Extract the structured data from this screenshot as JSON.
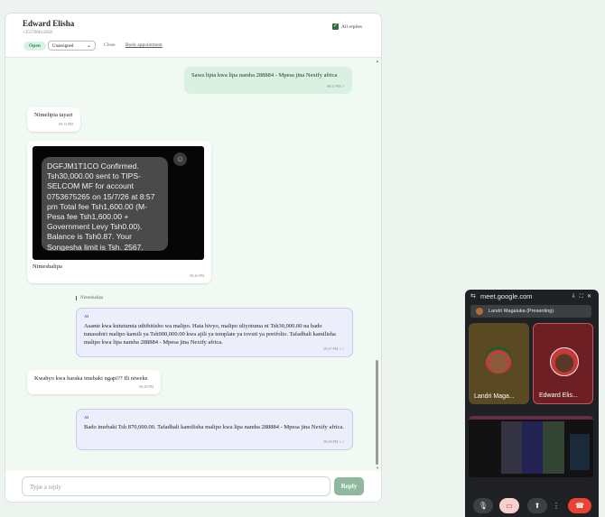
{
  "contact": {
    "name": "Edward Elisha",
    "phone": "+255766615858"
  },
  "header": {
    "status": "Open",
    "assignee": "Unassigned",
    "close_label": "Close",
    "book_label": "Book appointment",
    "all_replies_label": "All replies",
    "all_replies_checked": true
  },
  "messages": [
    {
      "dir": "out",
      "text": "Sawa lipia kwa lipa namba 288884 - Mpesa jina Nexify africa",
      "time": "09:11 PM ✓"
    },
    {
      "dir": "in",
      "text": "Nimelipia tayari",
      "time": "09:13 PM"
    },
    {
      "dir": "in",
      "image_text": "DGFJM1T1CO Confirmed. Tsh30,000.00 sent to TIPS-SELCOM MF for account 0753675265 on 15/7/26 at 8:57 pm Total fee Tsh1,600.00 (M-Pesa fee Tsh1,600.00 + Government Levy Tsh0.00). Balance is Tsh0.87. Your Songesha limit is Tsh. 2567.",
      "caption": "Nimeshalipa",
      "time": "09:26 PM"
    },
    {
      "dir": "out",
      "quote": "Nimeshalipa",
      "tag": "AI",
      "text": "Asante kwa kututumia uthibitisho wa malipo. Hata hivyo, malipo uliyotuma ni Tsh30,000.00 na bado tunasubiri malipo kamili ya Tsh900,000.00 kwa ajili ya template ya tovuti ya portfolio. Tafadhali kamilisha malipo kwa lipa namba 288884 - Mpesa jina Nexify africa.",
      "time": "09:27 PM ✓✓"
    },
    {
      "dir": "in",
      "text": "Kwahyo kwa haraka imebaki ngapi?? Ili niweke",
      "time": "09:28 PM"
    },
    {
      "dir": "out",
      "tag": "AI",
      "text": "Bado imebaki Tsh 870,000.00. Tafadhali kamilisha malipo kwa lipa namba 288884 - Mpesa jina Nexify africa.",
      "time": "09:28 PM ✓✓"
    }
  ],
  "composer": {
    "placeholder": "Type a reply",
    "reply_label": "Reply"
  },
  "meet": {
    "url": "meet.google.com",
    "presenting": "Landri Magaluka (Presenting)",
    "participants": [
      "Landri Maga...",
      "Edward Elis..."
    ],
    "icons": {
      "mic": "microphone-icon",
      "camera": "camera-off-icon",
      "present": "present-screen-icon",
      "more": "more-vert-icon",
      "hangup": "hang-up-icon"
    }
  }
}
